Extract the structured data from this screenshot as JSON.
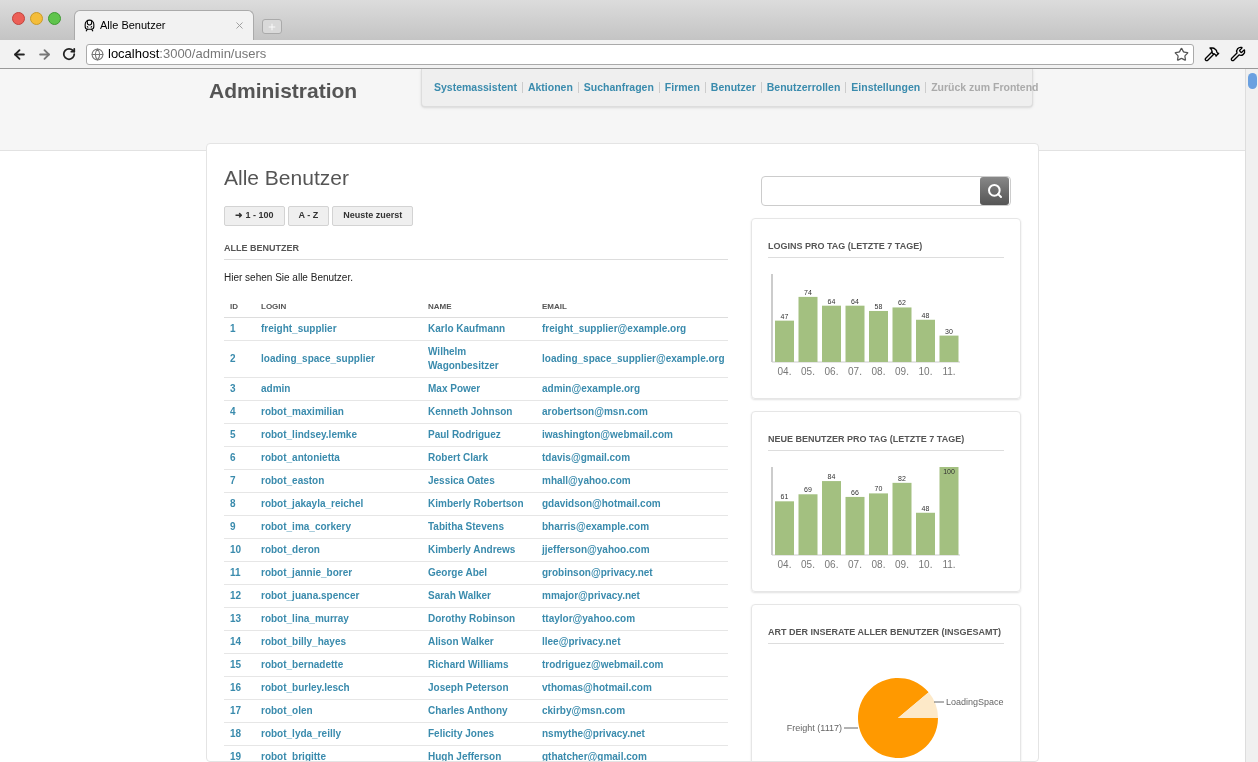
{
  "browser": {
    "tab_title": "Alle Benutzer",
    "url_host": "localhost",
    "url_path": ":3000/admin/users"
  },
  "header": {
    "title": "Administration",
    "nav": [
      {
        "label": "Systemassistent",
        "kind": "link"
      },
      {
        "label": "Aktionen",
        "kind": "link"
      },
      {
        "label": "Suchanfragen",
        "kind": "link"
      },
      {
        "label": "Firmen",
        "kind": "link"
      },
      {
        "label": "Benutzer",
        "kind": "link"
      },
      {
        "label": "Benutzerrollen",
        "kind": "link"
      },
      {
        "label": "Einstellungen",
        "kind": "link"
      },
      {
        "label": "Zurück zum Frontend",
        "kind": "muted"
      }
    ]
  },
  "page": {
    "title": "Alle Benutzer",
    "buttons": [
      "➜ 1 - 100",
      "A - Z",
      "Neuste zuerst"
    ],
    "section_heading": "ALLE BENUTZER",
    "intro": "Hier sehen Sie alle Benutzer.",
    "table": {
      "columns": [
        "ID",
        "LOGIN",
        "NAME",
        "EMAIL"
      ],
      "rows": [
        [
          "1",
          "freight_supplier",
          "Karlo Kaufmann",
          "freight_supplier@example.org"
        ],
        [
          "2",
          "loading_space_supplier",
          "Wilhelm Wagonbesitzer",
          "loading_space_supplier@example.org"
        ],
        [
          "3",
          "admin",
          "Max Power",
          "admin@example.org"
        ],
        [
          "4",
          "robot_maximilian",
          "Kenneth Johnson",
          "arobertson@msn.com"
        ],
        [
          "5",
          "robot_lindsey.lemke",
          "Paul Rodriguez",
          "iwashington@webmail.com"
        ],
        [
          "6",
          "robot_antonietta",
          "Robert Clark",
          "tdavis@gmail.com"
        ],
        [
          "7",
          "robot_easton",
          "Jessica Oates",
          "mhall@yahoo.com"
        ],
        [
          "8",
          "robot_jakayla_reichel",
          "Kimberly Robertson",
          "gdavidson@hotmail.com"
        ],
        [
          "9",
          "robot_ima_corkery",
          "Tabitha Stevens",
          "bharris@example.com"
        ],
        [
          "10",
          "robot_deron",
          "Kimberly Andrews",
          "jjefferson@yahoo.com"
        ],
        [
          "11",
          "robot_jannie_borer",
          "George Abel",
          "grobinson@privacy.net"
        ],
        [
          "12",
          "robot_juana.spencer",
          "Sarah Walker",
          "mmajor@privacy.net"
        ],
        [
          "13",
          "robot_lina_murray",
          "Dorothy Robinson",
          "ttaylor@yahoo.com"
        ],
        [
          "14",
          "robot_billy_hayes",
          "Alison Walker",
          "llee@privacy.net"
        ],
        [
          "15",
          "robot_bernadette",
          "Richard Williams",
          "trodriguez@webmail.com"
        ],
        [
          "16",
          "robot_burley.lesch",
          "Joseph Peterson",
          "vthomas@hotmail.com"
        ],
        [
          "17",
          "robot_olen",
          "Charles Anthony",
          "ckirby@msn.com"
        ],
        [
          "18",
          "robot_lyda_reilly",
          "Felicity Jones",
          "nsmythe@privacy.net"
        ],
        [
          "19",
          "robot_brigitte",
          "Hugh Jefferson",
          "gthatcher@gmail.com"
        ]
      ]
    }
  },
  "sidebar": {
    "panels": [
      {
        "kind": "bar",
        "title": "LOGINS PRO TAG (LETZTE 7 TAGE)",
        "chart_data": {
          "type": "bar",
          "categories": [
            "04.",
            "05.",
            "06.",
            "07.",
            "08.",
            "09.",
            "10.",
            "11."
          ],
          "values": [
            47,
            74,
            64,
            64,
            58,
            62,
            48,
            30
          ],
          "ylim": [
            0,
            100
          ],
          "data_labels": true
        }
      },
      {
        "kind": "bar",
        "title": "NEUE BENUTZER PRO TAG (LETZTE 7 TAGE)",
        "chart_data": {
          "type": "bar",
          "categories": [
            "04.",
            "05.",
            "06.",
            "07.",
            "08.",
            "09.",
            "10.",
            "11."
          ],
          "values": [
            61,
            69,
            84,
            66,
            70,
            82,
            48,
            100
          ],
          "ylim": [
            0,
            100
          ],
          "data_labels": true
        }
      },
      {
        "kind": "pie",
        "title": "ART DER INSERATE ALLER BENUTZER (INSGESAMT)",
        "slices": [
          {
            "label": "Freight (1117)",
            "color": "#ff9900"
          },
          {
            "label": "LoadingSpace",
            "color": "#fde9c8"
          }
        ]
      }
    ]
  }
}
